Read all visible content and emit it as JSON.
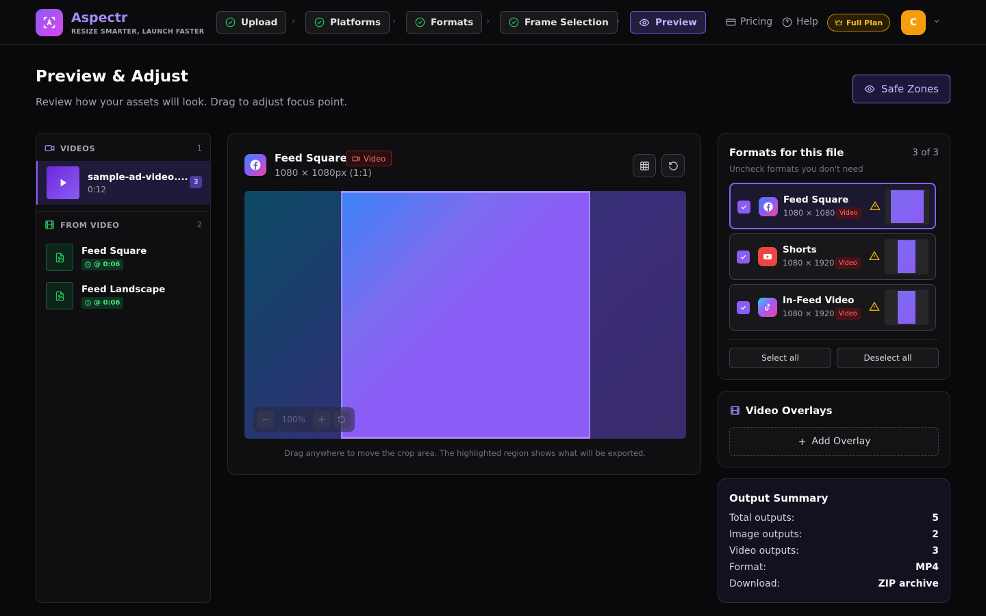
{
  "brand": {
    "name": "Aspectr",
    "tagline": "RESIZE SMARTER, LAUNCH FASTER"
  },
  "steps": [
    {
      "label": "Upload",
      "state": "done"
    },
    {
      "label": "Platforms",
      "state": "done"
    },
    {
      "label": "Formats",
      "state": "done"
    },
    {
      "label": "Frame Selection",
      "state": "done"
    },
    {
      "label": "Preview",
      "state": "active"
    }
  ],
  "header": {
    "pricing": "Pricing",
    "help": "Help",
    "plan": "Full Plan",
    "avatar_initial": "C"
  },
  "page": {
    "title": "Preview & Adjust",
    "subtitle": "Review how your assets will look. Drag to adjust focus point.",
    "safe_zones": "Safe Zones"
  },
  "left": {
    "videos_label": "VIDEOS",
    "videos_count": "1",
    "video": {
      "name": "sample-ad-video....",
      "duration": "0:12",
      "badge": "3"
    },
    "from_video_label": "FROM VIDEO",
    "from_video_count": "2",
    "frames": [
      {
        "name": "Feed Square",
        "time": "@ 0:06"
      },
      {
        "name": "Feed Landscape",
        "time": "@ 0:06"
      }
    ]
  },
  "center": {
    "title": "Feed Square",
    "tag": "Video",
    "dims": "1080 × 1080px (1:1)",
    "zoom": "100%",
    "hint": "Drag anywhere to move the crop area. The highlighted region shows what will be exported."
  },
  "formats_panel": {
    "title": "Formats for this file",
    "count": "3 of 3",
    "subtitle": "Uncheck formats you don't need",
    "items": [
      {
        "name": "Feed Square",
        "dims": "1080 × 1080",
        "tag": "Video",
        "platform": "facebook"
      },
      {
        "name": "Shorts",
        "dims": "1080 × 1920",
        "tag": "Video",
        "platform": "youtube"
      },
      {
        "name": "In-Feed Video",
        "dims": "1080 × 1920",
        "tag": "Video",
        "platform": "tiktok"
      }
    ],
    "select_all": "Select all",
    "deselect_all": "Deselect all"
  },
  "overlays": {
    "title": "Video Overlays",
    "add": "Add Overlay"
  },
  "summary": {
    "title": "Output Summary",
    "rows": [
      {
        "label": "Total outputs:",
        "value": "5"
      },
      {
        "label": "Image outputs:",
        "value": "2"
      },
      {
        "label": "Video outputs:",
        "value": "3"
      },
      {
        "label": "Format:",
        "value": "MP4"
      },
      {
        "label": "Download:",
        "value": "ZIP archive"
      }
    ]
  },
  "colors": {
    "accent": "#8b5cf6",
    "success": "#22c55e",
    "warning": "#eab308",
    "danger": "#f87171"
  }
}
